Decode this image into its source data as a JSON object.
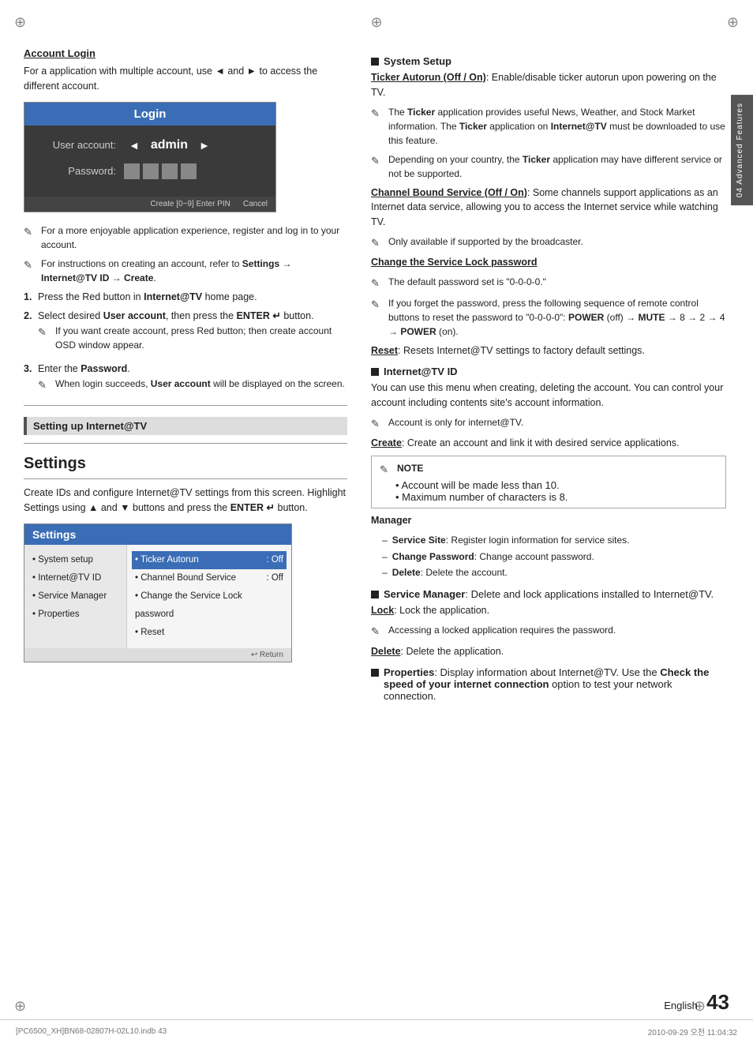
{
  "page": {
    "number": "43",
    "english_label": "English",
    "crosshair": "⊕",
    "bottom_left": "[PC6500_XH]BN68-02807H-02L10.indb   43",
    "bottom_right": "2010-09-29   오전 11:04:32"
  },
  "side_tab": {
    "label": "04 Advanced Features"
  },
  "left_col": {
    "account_login": {
      "heading": "Account Login",
      "desc": "For a application with multiple account, use ◄ and ► to access the different account.",
      "dialog": {
        "title": "Login",
        "user_label": "User account:",
        "user_value": "admin",
        "password_label": "Password:",
        "footer_create": "Create  [0~9] Enter PIN",
        "footer_cancel": "Cancel"
      },
      "notes": [
        "For a more enjoyable application experience, register and log in to your account.",
        "For instructions on creating an account, refer to Settings → Internet@TV ID → Create."
      ],
      "steps": [
        {
          "num": "1.",
          "text": "Press the Red button in Internet@TV home page."
        },
        {
          "num": "2.",
          "text": "Select desired User account, then press the ENTER  button.",
          "sub_note": "If you want create account, press Red button; then create account OSD window appear."
        },
        {
          "num": "3.",
          "text": "Enter the Password.",
          "sub_note": "When login succeeds, User account will be displayed on the screen."
        }
      ]
    },
    "setting_up": {
      "heading": "Setting up Internet@TV"
    },
    "settings": {
      "heading": "Settings",
      "desc": "Create IDs and configure Internet@TV settings from this screen. Highlight Settings using ▲ and ▼ buttons and press the ENTER  button.",
      "dialog": {
        "title": "Settings",
        "left_items": [
          "• System setup",
          "• Internet@TV ID",
          "• Service Manager",
          "• Properties"
        ],
        "right_items": [
          {
            "label": "• Ticker Autorun",
            "value": ": Off",
            "highlighted": true
          },
          {
            "label": "• Channel Bound Service",
            "value": ": Off",
            "highlighted": false
          },
          {
            "label": "• Change the Service Lock password",
            "value": "",
            "highlighted": false
          },
          {
            "label": "• Reset",
            "value": "",
            "highlighted": false
          }
        ],
        "footer": "Return"
      }
    }
  },
  "right_col": {
    "system_setup": {
      "heading": "System Setup",
      "ticker_autorun": {
        "title": "Ticker Autorun (Off / On)",
        "text": ": Enable/disable ticker autorun upon powering on the TV.",
        "notes": [
          "The Ticker application provides useful News, Weather, and Stock Market information. The Ticker application on Internet@TV must be downloaded to use this feature.",
          "Depending on your country, the Ticker application may have different service or not be supported."
        ]
      },
      "channel_bound": {
        "title": "Channel Bound Service (Off / On)",
        "text": ": Some channels support applications as an Internet data service, allowing you to access the Internet service while watching TV.",
        "note": "Only available if supported by the broadcaster."
      },
      "change_lock": {
        "title": "Change the Service Lock password",
        "notes": [
          "The default password set is \"0-0-0-0.\"",
          "If you forget the password, press the following sequence of remote control buttons to reset the password to \"0-0-0-0\": POWER (off) → MUTE → 8 → 2 → 4 → POWER (on)."
        ]
      },
      "reset": {
        "title": "Reset",
        "text": ": Resets Internet@TV settings to factory default settings."
      }
    },
    "internet_tv_id": {
      "heading": "Internet@TV ID",
      "desc": "You can use this menu when creating, deleting the account. You can control your account including contents site's account information.",
      "note": "Account is only for internet@TV.",
      "create": {
        "title": "Create",
        "text": ": Create an account and link it with desired service applications."
      },
      "note_block": {
        "title": "NOTE",
        "items": [
          "Account will be made less than 10.",
          "Maximum number of characters is 8."
        ]
      },
      "manager": {
        "title": "Manager",
        "items": [
          {
            "label": "Service Site",
            "text": ": Register login information for service sites."
          },
          {
            "label": "Change Password",
            "text": ": Change account password."
          },
          {
            "label": "Delete",
            "text": ": Delete the account."
          }
        ]
      }
    },
    "service_manager": {
      "heading": "Service Manager",
      "text": ": Delete and lock applications installed to Internet@TV.",
      "lock": {
        "title": "Lock",
        "text": ": Lock the application.",
        "note": "Accessing a locked application requires the password."
      },
      "delete": {
        "title": "Delete",
        "text": ": Delete the application."
      }
    },
    "properties": {
      "heading": "Properties",
      "text": ": Display information about Internet@TV. Use the Check the speed of your internet connection option to test your network connection."
    }
  }
}
